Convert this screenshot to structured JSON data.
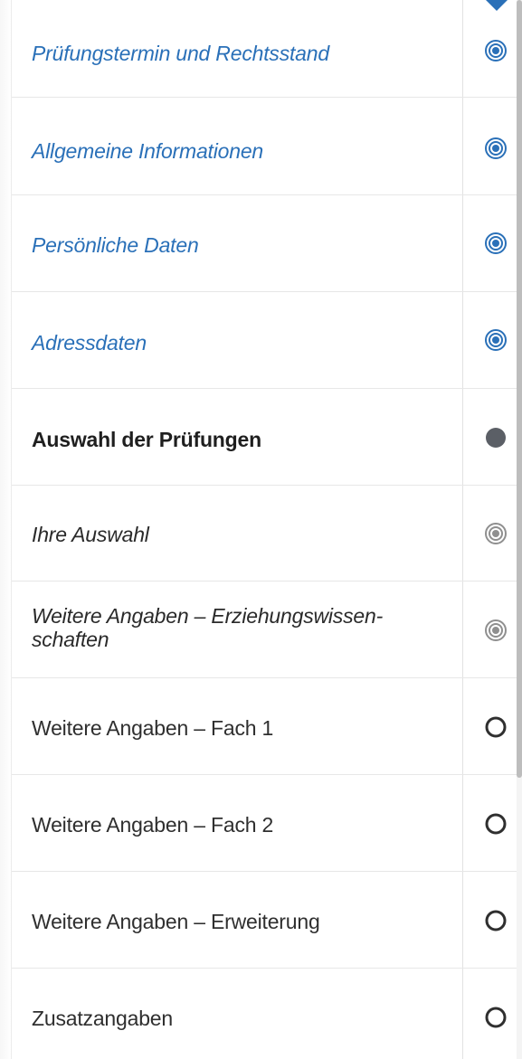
{
  "steps": [
    {
      "label": "Prüfungstermin und Rechtsstand",
      "state": "visited",
      "icon": "target-icon"
    },
    {
      "label": "Allgemeine Informationen",
      "state": "visited",
      "icon": "target-icon"
    },
    {
      "label": "Persönliche Daten",
      "state": "visited",
      "icon": "target-icon"
    },
    {
      "label": "Adressdaten",
      "state": "visited",
      "icon": "target-icon"
    },
    {
      "label": "Auswahl der Prüfungen",
      "state": "current",
      "icon": "filled-circle-icon"
    },
    {
      "label": "Ihre Auswahl",
      "state": "prev",
      "icon": "target-icon"
    },
    {
      "label": "Weitere Angaben – Erziehungswissen-",
      "label2": "schaften",
      "state": "prev",
      "icon": "target-icon"
    },
    {
      "label": "Weitere Angaben – Fach 1",
      "state": "pending",
      "icon": "empty-circle-icon"
    },
    {
      "label": "Weitere Angaben – Fach 2",
      "state": "pending",
      "icon": "empty-circle-icon"
    },
    {
      "label": "Weitere Angaben – Erweiterung",
      "state": "pending",
      "icon": "empty-circle-icon"
    },
    {
      "label": "Zusatzangaben",
      "state": "pending",
      "icon": "empty-circle-icon"
    }
  ],
  "colors": {
    "visited": "#2a70b8",
    "current": "#5b5f66",
    "prev": "#8f8f8f",
    "pending": "#2f2f2f"
  }
}
